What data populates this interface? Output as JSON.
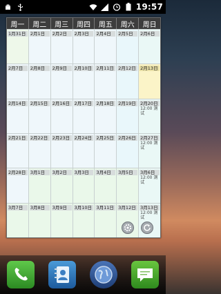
{
  "status_bar": {
    "time": "19:57",
    "left_icons": [
      "android-debug-icon",
      "usb-icon"
    ],
    "right_icons": [
      "wifi-icon",
      "signal-icon",
      "alarm-icon",
      "battery-icon"
    ]
  },
  "calendar": {
    "weekdays": [
      "周一",
      "周二",
      "周三",
      "周四",
      "周五",
      "周六",
      "周日"
    ],
    "weeks": [
      {
        "days": [
          {
            "label": "1月31日",
            "style": "mon"
          },
          {
            "label": "2月1日",
            "style": ""
          },
          {
            "label": "2月2日",
            "style": ""
          },
          {
            "label": "2月3日",
            "style": ""
          },
          {
            "label": "2月4日",
            "style": ""
          },
          {
            "label": "2月5日",
            "style": "sat"
          },
          {
            "label": "2月6日",
            "style": "sun"
          }
        ]
      },
      {
        "days": [
          {
            "label": "2月7日",
            "style": ""
          },
          {
            "label": "2月8日",
            "style": ""
          },
          {
            "label": "2月9日",
            "style": ""
          },
          {
            "label": "2月10日",
            "style": ""
          },
          {
            "label": "2月11日",
            "style": ""
          },
          {
            "label": "2月12日",
            "style": "sat"
          },
          {
            "label": "2月13日",
            "style": "today"
          }
        ]
      },
      {
        "days": [
          {
            "label": "2月14日",
            "style": ""
          },
          {
            "label": "2月15日",
            "style": ""
          },
          {
            "label": "2月16日",
            "style": ""
          },
          {
            "label": "2月17日",
            "style": ""
          },
          {
            "label": "2月18日",
            "style": ""
          },
          {
            "label": "2月19日",
            "style": "sat"
          },
          {
            "label": "2月20日",
            "style": "sun",
            "event_time": "12:00 测",
            "event_title": "试"
          }
        ]
      },
      {
        "days": [
          {
            "label": "2月21日",
            "style": ""
          },
          {
            "label": "2月22日",
            "style": ""
          },
          {
            "label": "2月23日",
            "style": ""
          },
          {
            "label": "2月24日",
            "style": ""
          },
          {
            "label": "2月25日",
            "style": ""
          },
          {
            "label": "2月26日",
            "style": "sat"
          },
          {
            "label": "2月27日",
            "style": "sun",
            "event_time": "12:00 测",
            "event_title": "试"
          }
        ]
      },
      {
        "days": [
          {
            "label": "2月28日",
            "style": ""
          },
          {
            "label": "3月1日",
            "style": "nextmonth"
          },
          {
            "label": "3月2日",
            "style": "nextmonth"
          },
          {
            "label": "3月3日",
            "style": "nextmonth"
          },
          {
            "label": "3月4日",
            "style": "nextmonth"
          },
          {
            "label": "3月5日",
            "style": "nextmonth"
          },
          {
            "label": "3月6日",
            "style": "sun",
            "event_time": "12:00 测",
            "event_title": "试"
          }
        ]
      },
      {
        "days": [
          {
            "label": "3月7日",
            "style": "nextmonth"
          },
          {
            "label": "3月8日",
            "style": "nextmonth"
          },
          {
            "label": "3月9日",
            "style": "nextmonth"
          },
          {
            "label": "3月10日",
            "style": "nextmonth"
          },
          {
            "label": "3月11日",
            "style": "nextmonth"
          },
          {
            "label": "3月12日",
            "style": "nextmonth"
          },
          {
            "label": "3月13日",
            "style": "sun",
            "event_time": "12:00 测",
            "event_title": "试"
          }
        ]
      }
    ],
    "buttons": [
      "settings-icon",
      "refresh-icon"
    ]
  },
  "dock": {
    "apps": [
      "phone-icon",
      "contacts-icon",
      "browser-icon",
      "messaging-icon"
    ]
  }
}
